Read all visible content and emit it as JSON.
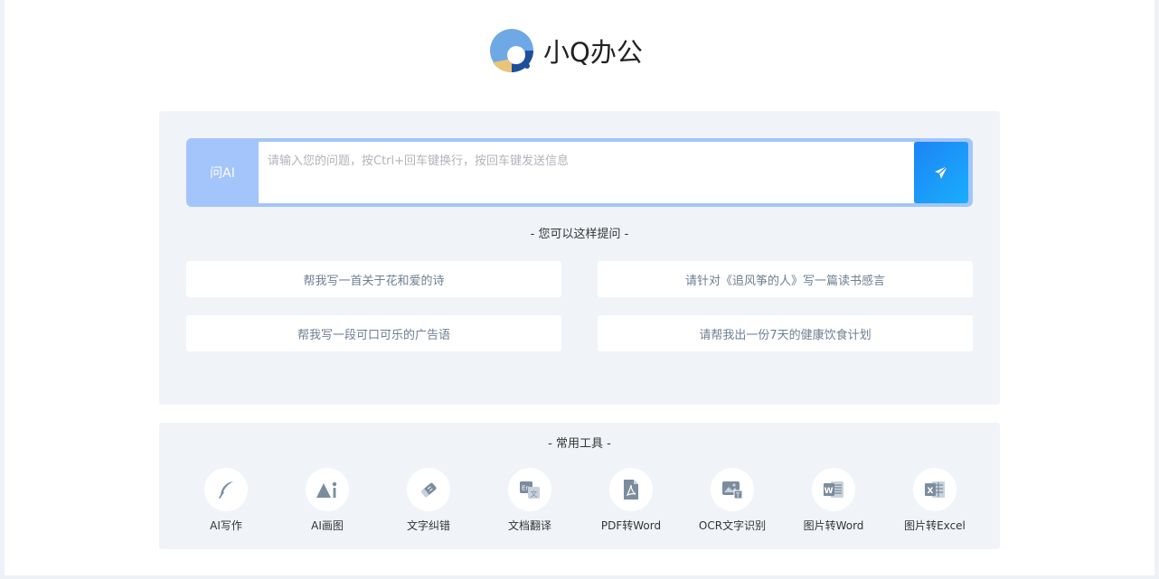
{
  "brand": {
    "name": "小Q办公",
    "colors": {
      "logo_blue": "#6ea9e6",
      "logo_dark": "#1f4f9a",
      "logo_gold": "#e9c47a"
    }
  },
  "ask": {
    "label": "问AI",
    "placeholder": "请输入您的问题，按Ctrl+回车键换行，按回车键发送信息",
    "value": "",
    "send_icon": "send-icon",
    "accent": "#a3c5fb",
    "send_gradient": [
      "#1c84f5",
      "#1aaefb"
    ]
  },
  "hints": {
    "title": "- 您可以这样提问 -",
    "items": [
      "帮我写一首关于花和爱的诗",
      "请针对《追风筝的人》写一篇读书感言",
      "帮我写一段可口可乐的广告语",
      "请帮我出一份7天的健康饮食计划"
    ]
  },
  "tools": {
    "title": "- 常用工具 -",
    "items": [
      {
        "label": "AI写作",
        "icon": "feather-pen-icon"
      },
      {
        "label": "AI画图",
        "icon": "ai-image-icon"
      },
      {
        "label": "文字纠错",
        "icon": "eraser-icon"
      },
      {
        "label": "文档翻译",
        "icon": "translate-icon"
      },
      {
        "label": "PDF转Word",
        "icon": "pdf-icon"
      },
      {
        "label": "OCR文字识别",
        "icon": "ocr-image-icon"
      },
      {
        "label": "图片转Word",
        "icon": "word-icon"
      },
      {
        "label": "图片转Excel",
        "icon": "excel-icon"
      }
    ],
    "icon_color": "#7b8c9e"
  }
}
